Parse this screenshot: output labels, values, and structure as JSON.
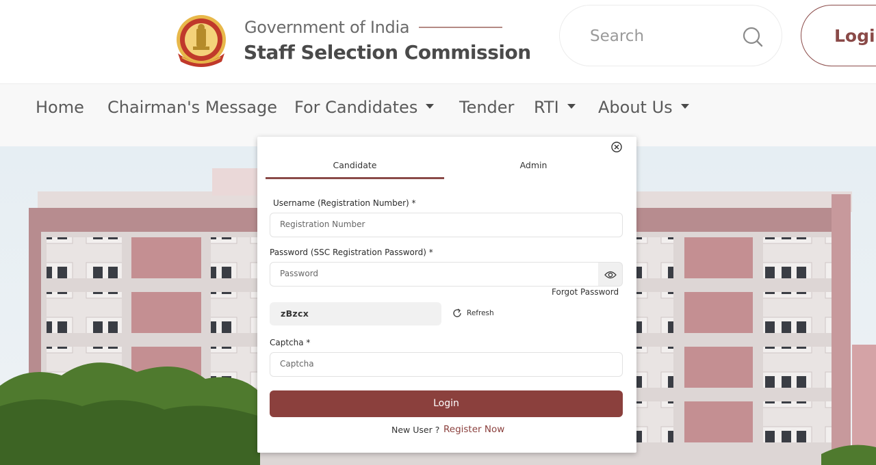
{
  "header": {
    "gov_text": "Government of India",
    "org_text": "Staff Selection Commission",
    "search_placeholder": "Search",
    "login_label": "Login",
    "emblem_icon": "ssc-emblem-icon",
    "search_icon": "search-icon"
  },
  "nav": {
    "items": [
      {
        "label": "Home",
        "has_dropdown": false
      },
      {
        "label": "Chairman's Message",
        "has_dropdown": false
      },
      {
        "label": "For Candidates",
        "has_dropdown": true
      },
      {
        "label": "Tender",
        "has_dropdown": false
      },
      {
        "label": "RTI",
        "has_dropdown": true
      },
      {
        "label": "About Us",
        "has_dropdown": true
      }
    ]
  },
  "modal": {
    "tabs": [
      {
        "label": "Candidate",
        "active": true
      },
      {
        "label": "Admin",
        "active": false
      }
    ],
    "username_label": "Username (Registration Number) *",
    "username_placeholder": "Registration Number",
    "password_label": "Password (SSC Registration Password) *",
    "password_placeholder": "Password",
    "forgot_label": "Forgot Password",
    "captcha_text": "zBzcx",
    "refresh_label": "Refresh",
    "captcha_label": "Captcha *",
    "captcha_placeholder": "Captcha",
    "login_label": "Login",
    "new_user_text": "New User ?",
    "register_label": "Register Now"
  },
  "colors": {
    "accent": "#8b403d",
    "nav_bg": "#f8f8f8"
  }
}
